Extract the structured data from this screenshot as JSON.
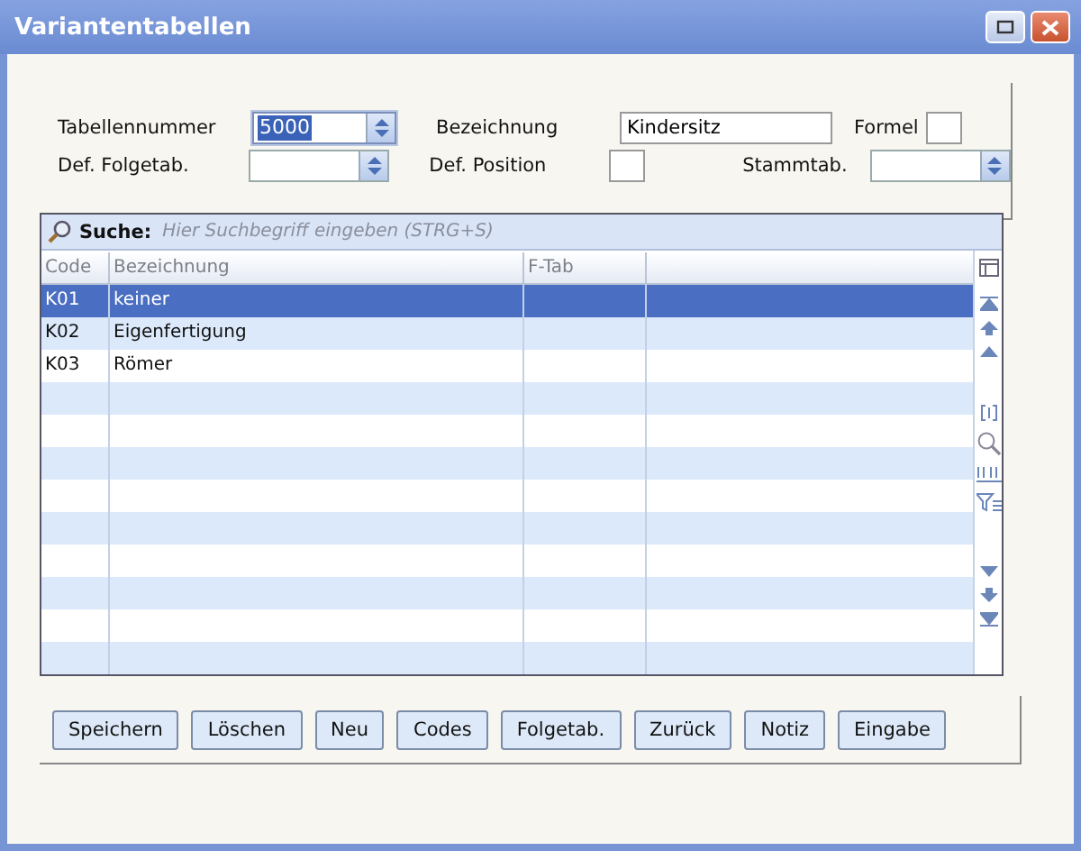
{
  "window": {
    "title": "Variantentabellen"
  },
  "form": {
    "tabellennummer": {
      "label": "Tabellennummer",
      "value": "5000"
    },
    "bezeichnung": {
      "label": "Bezeichnung",
      "value": "Kindersitz"
    },
    "formel": {
      "label": "Formel"
    },
    "folgetab": {
      "label": "Def. Folgetab."
    },
    "position": {
      "label": "Def. Position"
    },
    "stammtab": {
      "label": "Stammtab."
    }
  },
  "search": {
    "label": "Suche:",
    "placeholder": "Hier Suchbegriff eingeben (STRG+S)"
  },
  "table": {
    "columns": [
      "Code",
      "Bezeichnung",
      "F-Tab"
    ],
    "rows": [
      {
        "code": "K01",
        "bezeichnung": "keiner",
        "selected": true
      },
      {
        "code": "K02",
        "bezeichnung": "Eigenfertigung",
        "selected": false
      },
      {
        "code": "K03",
        "bezeichnung": "Römer",
        "selected": false
      }
    ]
  },
  "buttons": [
    "Speichern",
    "Löschen",
    "Neu",
    "Codes",
    "Folgetab.",
    "Zurück",
    "Notiz",
    "Eingabe"
  ]
}
